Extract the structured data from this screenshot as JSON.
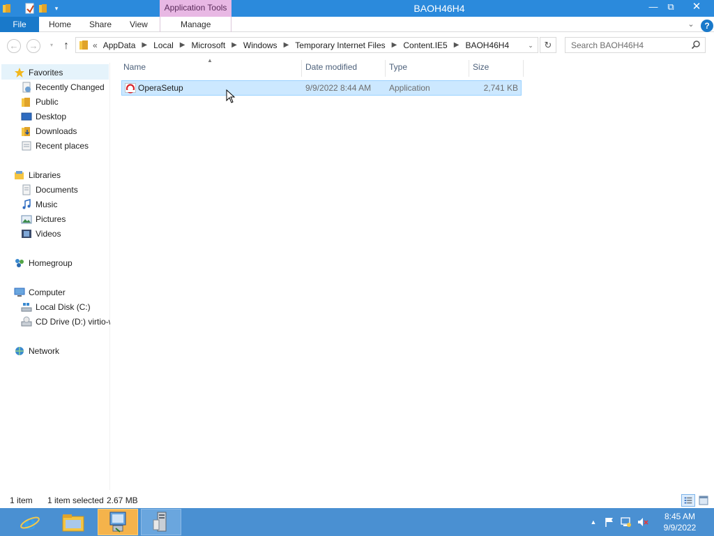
{
  "window": {
    "title": "BAOH46H4",
    "context_tab": "Application Tools"
  },
  "ribbon": {
    "file": "File",
    "tabs": [
      "Home",
      "Share",
      "View",
      "Manage"
    ]
  },
  "address": {
    "lead": "«",
    "crumbs": [
      "AppData",
      "Local",
      "Microsoft",
      "Windows",
      "Temporary Internet Files",
      "Content.IE5",
      "BAOH46H4"
    ]
  },
  "search": {
    "placeholder": "Search BAOH46H4"
  },
  "navpane": {
    "favorites": {
      "label": "Favorites",
      "items": [
        "Recently Changed",
        "Public",
        "Desktop",
        "Downloads",
        "Recent places"
      ]
    },
    "libraries": {
      "label": "Libraries",
      "items": [
        "Documents",
        "Music",
        "Pictures",
        "Videos"
      ]
    },
    "homegroup": {
      "label": "Homegroup"
    },
    "computer": {
      "label": "Computer",
      "items": [
        "Local Disk (C:)",
        "CD Drive (D:) virtio-win"
      ]
    },
    "network": {
      "label": "Network"
    }
  },
  "columns": {
    "name": "Name",
    "date": "Date modified",
    "type": "Type",
    "size": "Size"
  },
  "files": [
    {
      "name": "OperaSetup",
      "date": "9/9/2022 8:44 AM",
      "type": "Application",
      "size": "2,741 KB",
      "selected": true
    }
  ],
  "status": {
    "count": "1 item",
    "selection": "1 item selected",
    "size": "2.67 MB"
  },
  "taskbar": {
    "apps": [
      "internet-explorer",
      "file-explorer",
      "installer",
      "server-manager"
    ]
  },
  "clock": {
    "time": "8:45 AM",
    "date": "9/9/2022"
  },
  "colors": {
    "accent": "#2b8adc",
    "selection": "#cce8ff",
    "taskbar": "#4a90d2",
    "context_tab": "#e8b8e4"
  }
}
